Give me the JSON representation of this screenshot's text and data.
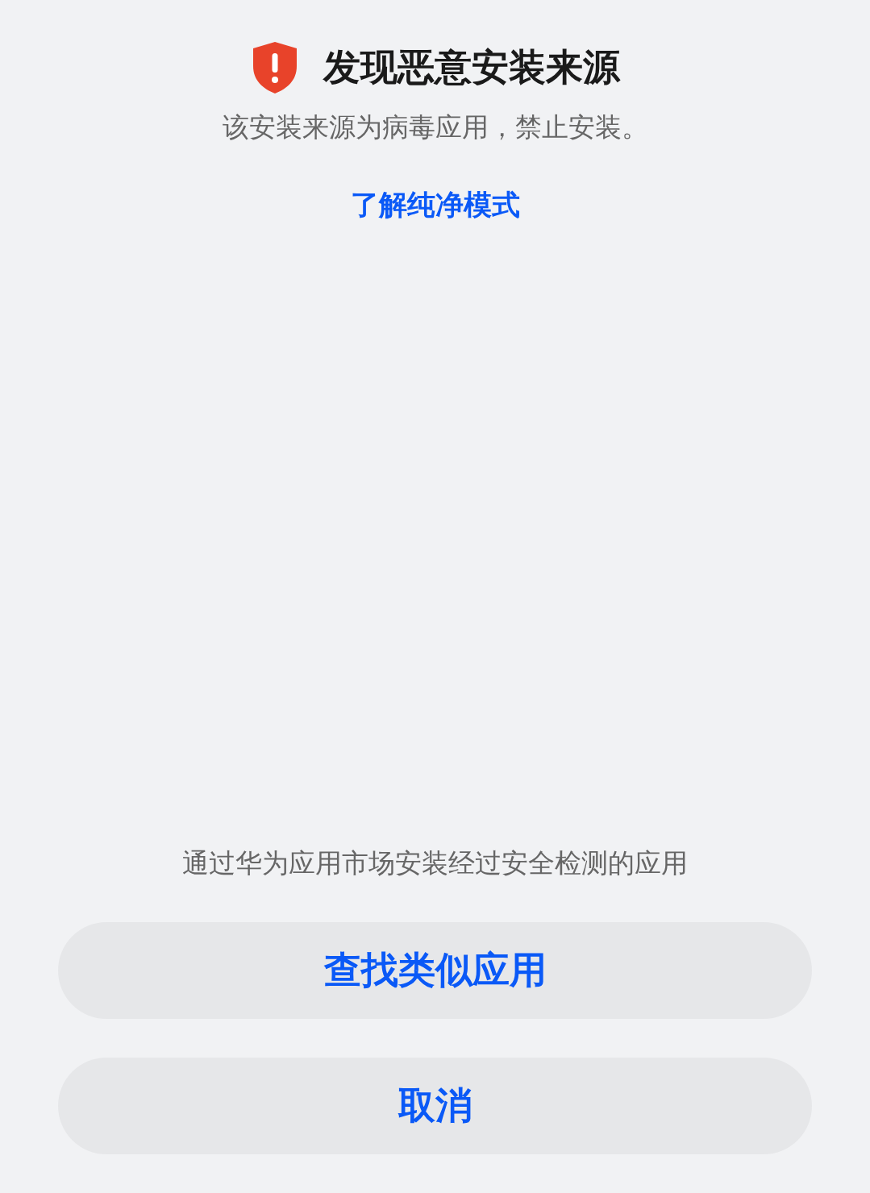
{
  "dialog": {
    "title": "发现恶意安装来源",
    "message": "该安装来源为病毒应用，禁止安装。",
    "link": "了解纯净模式"
  },
  "footer": {
    "hint": "通过华为应用市场安装经过安全检测的应用",
    "buttons": [
      {
        "label": "查找类似应用"
      },
      {
        "label": "取消"
      }
    ]
  }
}
